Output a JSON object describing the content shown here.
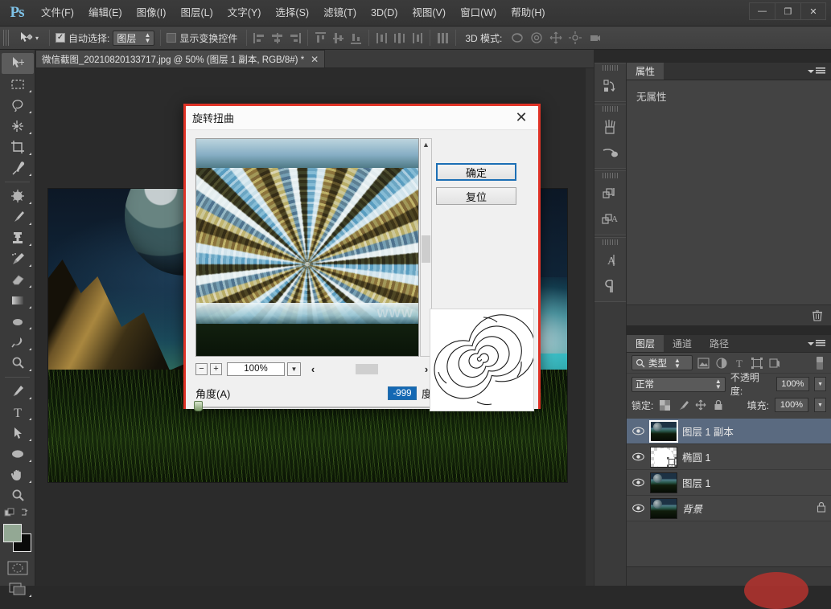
{
  "app": {
    "logo": "Ps",
    "window_controls": {
      "minimize": "—",
      "maximize": "❐",
      "close": "✕"
    }
  },
  "menubar": {
    "items": [
      {
        "label": "文件(F)"
      },
      {
        "label": "编辑(E)"
      },
      {
        "label": "图像(I)"
      },
      {
        "label": "图层(L)"
      },
      {
        "label": "文字(Y)"
      },
      {
        "label": "选择(S)"
      },
      {
        "label": "滤镜(T)"
      },
      {
        "label": "3D(D)"
      },
      {
        "label": "视图(V)"
      },
      {
        "label": "窗口(W)"
      },
      {
        "label": "帮助(H)"
      }
    ]
  },
  "options_bar": {
    "auto_select_checked": true,
    "auto_select_label": "自动选择:",
    "auto_select_value": "图层",
    "show_transform_label": "显示变换控件",
    "show_transform_checked": false,
    "mode3d_label": "3D 模式:"
  },
  "document_tab": {
    "title": "微信截图_20210820133717.jpg @ 50% (图层 1 副本, RGB/8#) *",
    "close": "✕"
  },
  "dialog": {
    "title": "旋转扭曲",
    "close": "✕",
    "ok_label": "确定",
    "reset_label": "复位",
    "zoom_value": "100%",
    "zoom_out": "−",
    "zoom_in": "+",
    "scroll_left": "‹",
    "scroll_right": "›",
    "angle_label": "角度(A)",
    "angle_value": "-999",
    "angle_unit": "度",
    "watermark": "WWW"
  },
  "properties_panel": {
    "tabs": [
      {
        "label": "属性",
        "active": true
      }
    ],
    "empty_text": "无属性"
  },
  "layers_panel": {
    "tabs": [
      {
        "label": "图层",
        "active": true
      },
      {
        "label": "通道",
        "active": false
      },
      {
        "label": "路径",
        "active": false
      }
    ],
    "filter_value": "类型",
    "blend_mode": "正常",
    "opacity_label": "不透明度:",
    "opacity_value": "100%",
    "lock_label": "锁定:",
    "fill_label": "填充:",
    "fill_value": "100%",
    "layers": [
      {
        "name": "图层 1 副本",
        "selected": true,
        "thumb": "photo",
        "locked": false
      },
      {
        "name": "椭圆 1",
        "selected": false,
        "thumb": "mask",
        "locked": false
      },
      {
        "name": "图层 1",
        "selected": false,
        "thumb": "photo",
        "locked": false
      },
      {
        "name": "背景",
        "selected": false,
        "thumb": "photo",
        "locked": true
      }
    ]
  },
  "colors": {
    "dialog_border": "#e03327",
    "ok_focus": "#1c6fb5",
    "selection_blue": "#1468b3",
    "layer_selected": "#5a6a80",
    "foreground_swatch": "#93a894",
    "background_swatch": "#0a0a0a"
  }
}
